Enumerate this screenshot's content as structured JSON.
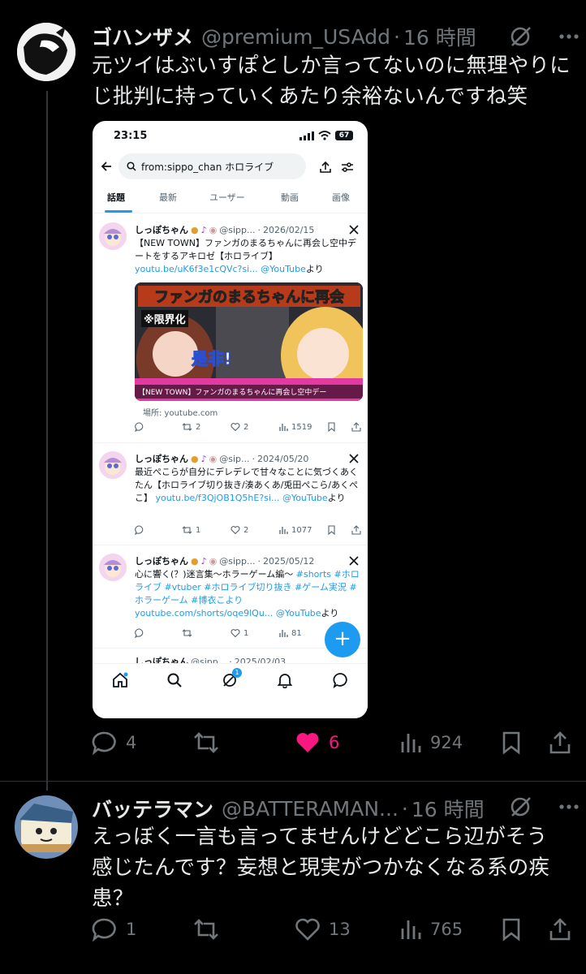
{
  "tweet1": {
    "name": "ゴハンザメ",
    "handle": "@premium_USAdd",
    "dot": "·",
    "time": "16 時間",
    "text": "元ツイはぶいすぽとしか言ってないのに無理やりにじ批判に持っていくあたり余裕ないんですね笑",
    "replies": "4",
    "likes": "6",
    "views": "924"
  },
  "phone": {
    "time": "23:15",
    "battery": "67",
    "search": "from:sippo_chan ホロライブ",
    "tabs": [
      "話題",
      "最新",
      "ユーザー",
      "動画",
      "画像"
    ],
    "tweets": [
      {
        "name": "しっぽちゃん",
        "handle": "@sipp...",
        "dot": "·",
        "date": "2026/02/15",
        "text_a": "【NEW TOWN】ファンガのまるちゃんに再会し空中デートをするアキロゼ【ホロライブ】",
        "link": "youtu.be/uK6f3e1cQVc?si...",
        "link_b": "@YouTube",
        "suffix": "より",
        "thumb_title": "ファンガのまるちゃんに再会",
        "thumb_badge": "※限界化",
        "thumb_word": "是非!",
        "thumb_caption": "【NEW TOWN】ファンガのまるちゃんに再会し空中デー",
        "place": "場所: youtube.com",
        "rt": "2",
        "likes": "2",
        "views": "1519"
      },
      {
        "name": "しっぽちゃん",
        "handle": "@sip...",
        "dot": "·",
        "date": "2024/05/20",
        "text_a": "最近ぺこらが自分にデレデレで甘々なことに気づくあくたん【ホロライブ切り抜き/湊あくあ/兎田ぺこら/あくぺこ】",
        "link": "youtu.be/f3QjOB1Q5hE?si...",
        "link_b": "@YouTube",
        "suffix": "より",
        "rt": "1",
        "likes": "2",
        "views": "1077"
      },
      {
        "name": "しっぽちゃん",
        "handle": "@sipp...",
        "dot": "·",
        "date": "2025/05/12",
        "text_a": "心に響く(？)迷言集〜ホラーゲーム編〜",
        "link": "#shorts #ホロライブ #vtuber #ホロライブ切り抜き #ゲーム実況 #ホラーゲーム #博衣こより",
        "link2": "youtube.com/shorts/oqe9lQu...",
        "link_b": "@YouTube",
        "suffix": "より",
        "likes": "1",
        "views": "81"
      },
      {
        "name": "しっぽちゃん",
        "handle": "@sipp...",
        "dot": "·",
        "date": "2025/02/03"
      }
    ],
    "nav_badge": "1",
    "fab": "+"
  },
  "tweet2": {
    "name": "バッテラマン",
    "handle": "@BATTERAMAN...",
    "dot": "·",
    "time": "16 時間",
    "text": "えっぼく一言も言ってませんけどどこら辺がそう感じたんです？妄想と現実がつかなくなる系の疾患？",
    "replies": "1",
    "likes": "13",
    "views": "765"
  },
  "colors": {
    "accent": "#1d9bf0",
    "like_active": "#f91880",
    "muted": "#71767b",
    "text": "#e7e9ea"
  },
  "icons": [
    "grok-icon",
    "more-icon",
    "reply-icon",
    "retweet-icon",
    "like-icon",
    "views-icon",
    "bookmark-icon",
    "share-icon"
  ]
}
